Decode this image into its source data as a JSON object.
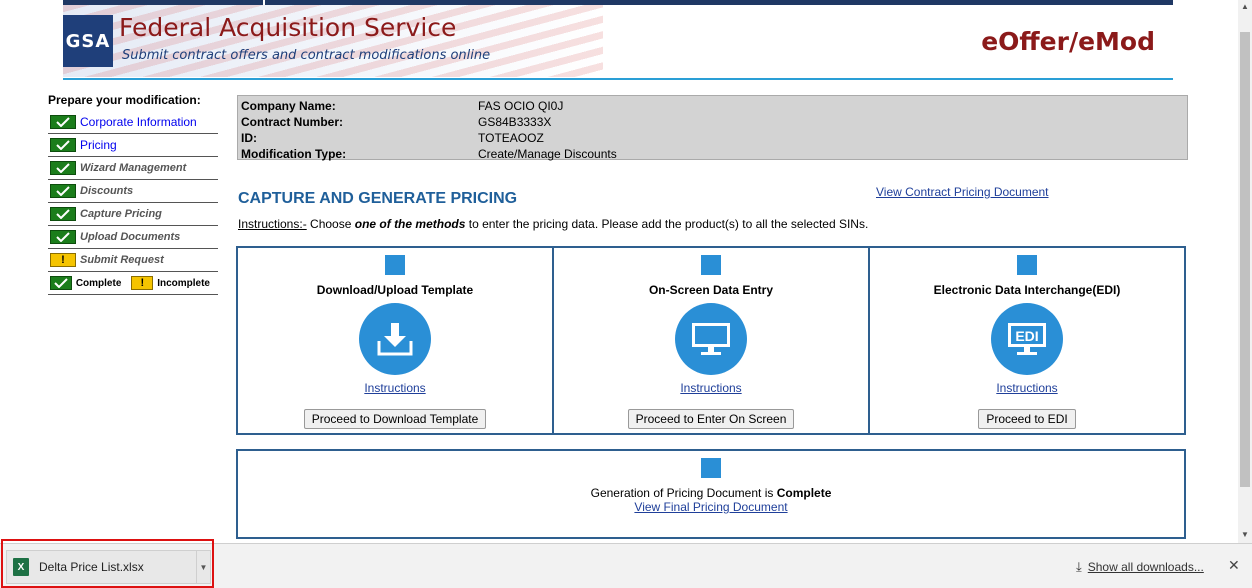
{
  "header": {
    "logo_text": "GSA",
    "title": "Federal Acquisition Service",
    "subtitle": "Submit contract offers and contract modifications online",
    "app_name": "eOffer/eMod"
  },
  "sidebar": {
    "title": "Prepare your modification:",
    "items": [
      {
        "label": "Corporate Information",
        "status": "complete",
        "link": true
      },
      {
        "label": "Pricing",
        "status": "complete",
        "link": true
      },
      {
        "label": "Wizard Management",
        "status": "complete",
        "link": false
      },
      {
        "label": "Discounts",
        "status": "complete",
        "link": false
      },
      {
        "label": "Capture Pricing",
        "status": "complete",
        "link": false
      },
      {
        "label": "Upload Documents",
        "status": "complete",
        "link": false
      },
      {
        "label": "Submit Request",
        "status": "incomplete",
        "link": false
      }
    ],
    "legend": {
      "complete": "Complete",
      "incomplete": "Incomplete",
      "warn_glyph": "!"
    }
  },
  "info": {
    "rows": [
      {
        "label": "Company Name:",
        "value": "FAS OCIO QI0J"
      },
      {
        "label": "Contract Number:",
        "value": "GS84B3333X"
      },
      {
        "label": "ID:",
        "value": "TOTEAOOZ"
      },
      {
        "label": "Modification Type:",
        "value": "Create/Manage Discounts"
      }
    ]
  },
  "main": {
    "section_title": "CAPTURE AND GENERATE PRICING",
    "view_contract_link": "View Contract Pricing Document",
    "instructions_label": "Instructions:-",
    "instructions_pre": " Choose ",
    "instructions_em": "one of the methods",
    "instructions_post": " to enter the pricing data. Please add the product(s) to all the selected SINs.",
    "methods": [
      {
        "title": "Download/Upload Template",
        "icon": "download-icon",
        "link": "Instructions ",
        "button": "Proceed to Download Template"
      },
      {
        "title": "On-Screen Data Entry",
        "icon": "monitor-icon",
        "link": "Instructions ",
        "button": "Proceed to Enter On Screen"
      },
      {
        "title": "Electronic Data Interchange(EDI)",
        "icon": "edi-monitor-icon",
        "icon_text": "EDI",
        "link": "Instructions",
        "button": "Proceed to EDI"
      }
    ],
    "generation": {
      "text_pre": "Generation of Pricing Document is ",
      "status": "Complete",
      "link": "View Final Pricing Document"
    }
  },
  "download_bar": {
    "file_name": "Delta Price List.xlsx",
    "file_icon_text": "X",
    "show_all": "Show all downloads...",
    "close_glyph": "✕"
  },
  "colors": {
    "accent_blue": "#2a8fd6",
    "title_red": "#8b1a1a",
    "complete_green": "#1b7d1b",
    "incomplete_yellow": "#f5c400"
  }
}
